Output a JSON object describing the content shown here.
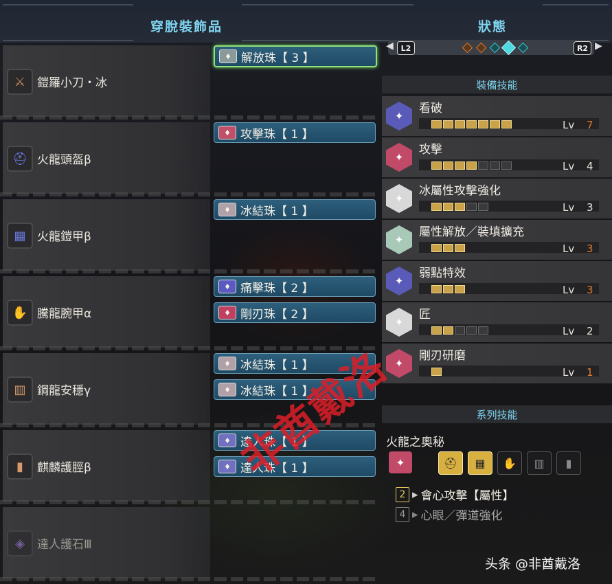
{
  "left_panel": {
    "title": "穿脫裝飾品",
    "equipment": [
      {
        "name": "鎧羅小刀・冰",
        "icon": "weapon-icon",
        "decorations": [
          {
            "label": "解放珠【 3 】",
            "selected": true,
            "gem_color": "#8a9a9a"
          }
        ]
      },
      {
        "name": "火龍頭盔β",
        "icon": "helmet-icon",
        "decorations": [
          {
            "label": "攻擊珠【 1 】",
            "selected": false,
            "gem_color": "#c0506a"
          }
        ]
      },
      {
        "name": "火龍鎧甲β",
        "icon": "chest-armor-icon",
        "decorations": [
          {
            "label": "冰結珠【 1 】",
            "selected": false,
            "gem_color": "#b0a0a8"
          }
        ]
      },
      {
        "name": "騰龍腕甲α",
        "icon": "arm-armor-icon",
        "decorations": [
          {
            "label": "痛擊珠【 2 】",
            "selected": false,
            "gem_color": "#5a5ac0"
          },
          {
            "label": "剛刃珠【 2 】",
            "selected": false,
            "gem_color": "#c04060"
          }
        ]
      },
      {
        "name": "鋼龍安穩γ",
        "icon": "waist-armor-icon",
        "decorations": [
          {
            "label": "冰結珠【 1 】",
            "selected": false,
            "gem_color": "#b0a0a8"
          },
          {
            "label": "冰結珠【 1 】",
            "selected": false,
            "gem_color": "#b0a0a8"
          }
        ]
      },
      {
        "name": "麒麟護脛β",
        "icon": "leg-armor-icon",
        "decorations": [
          {
            "label": "達人珠【 1 】",
            "selected": false,
            "gem_color": "#7070c0"
          },
          {
            "label": "達人珠【 1 】",
            "selected": false,
            "gem_color": "#7070c0"
          }
        ]
      },
      {
        "name": "達人護石Ⅲ",
        "icon": "charm-icon",
        "decorations": []
      }
    ]
  },
  "right_panel": {
    "title": "狀態",
    "nav": {
      "left_button": "L2",
      "right_button": "R2"
    },
    "equip_skills_header": "裝備技能",
    "lv_label": "Lv",
    "skills": [
      {
        "name": "看破",
        "level": "7",
        "filled": 7,
        "max": 7,
        "level_color": "#e07a2c",
        "icon_color": "#5a5ab8"
      },
      {
        "name": "攻擊",
        "level": "4",
        "filled": 4,
        "max": 7,
        "level_color": "#e8e4dc",
        "icon_color": "#c04a68"
      },
      {
        "name": "冰屬性攻擊強化",
        "level": "3",
        "filled": 3,
        "max": 5,
        "level_color": "#e8e4dc",
        "icon_color": "#d8d8d8"
      },
      {
        "name": "屬性解放／裝填擴充",
        "level": "3",
        "filled": 3,
        "max": 3,
        "level_color": "#e07a2c",
        "icon_color": "#a8c8b8"
      },
      {
        "name": "弱點特效",
        "level": "3",
        "filled": 3,
        "max": 3,
        "level_color": "#e07a2c",
        "icon_color": "#5a5ab8"
      },
      {
        "name": "匠",
        "level": "2",
        "filled": 2,
        "max": 5,
        "level_color": "#e8e4dc",
        "icon_color": "#d8d8d8"
      },
      {
        "name": "剛刃研磨",
        "level": "1",
        "filled": 1,
        "max": 1,
        "level_color": "#e07a2c",
        "icon_color": "#c04a68"
      }
    ],
    "series_skills_header": "系列技能",
    "series": {
      "name": "火龍之奧秘",
      "pieces_equipped": 2,
      "pieces_total": 5,
      "bonuses": [
        {
          "count": "2",
          "label": "會心攻擊【屬性】",
          "active": true
        },
        {
          "count": "4",
          "label": "心眼／彈道強化",
          "active": false
        }
      ]
    }
  },
  "watermarks": {
    "center": "非酋戴洛",
    "credit": "头条 @非酋戴洛"
  }
}
